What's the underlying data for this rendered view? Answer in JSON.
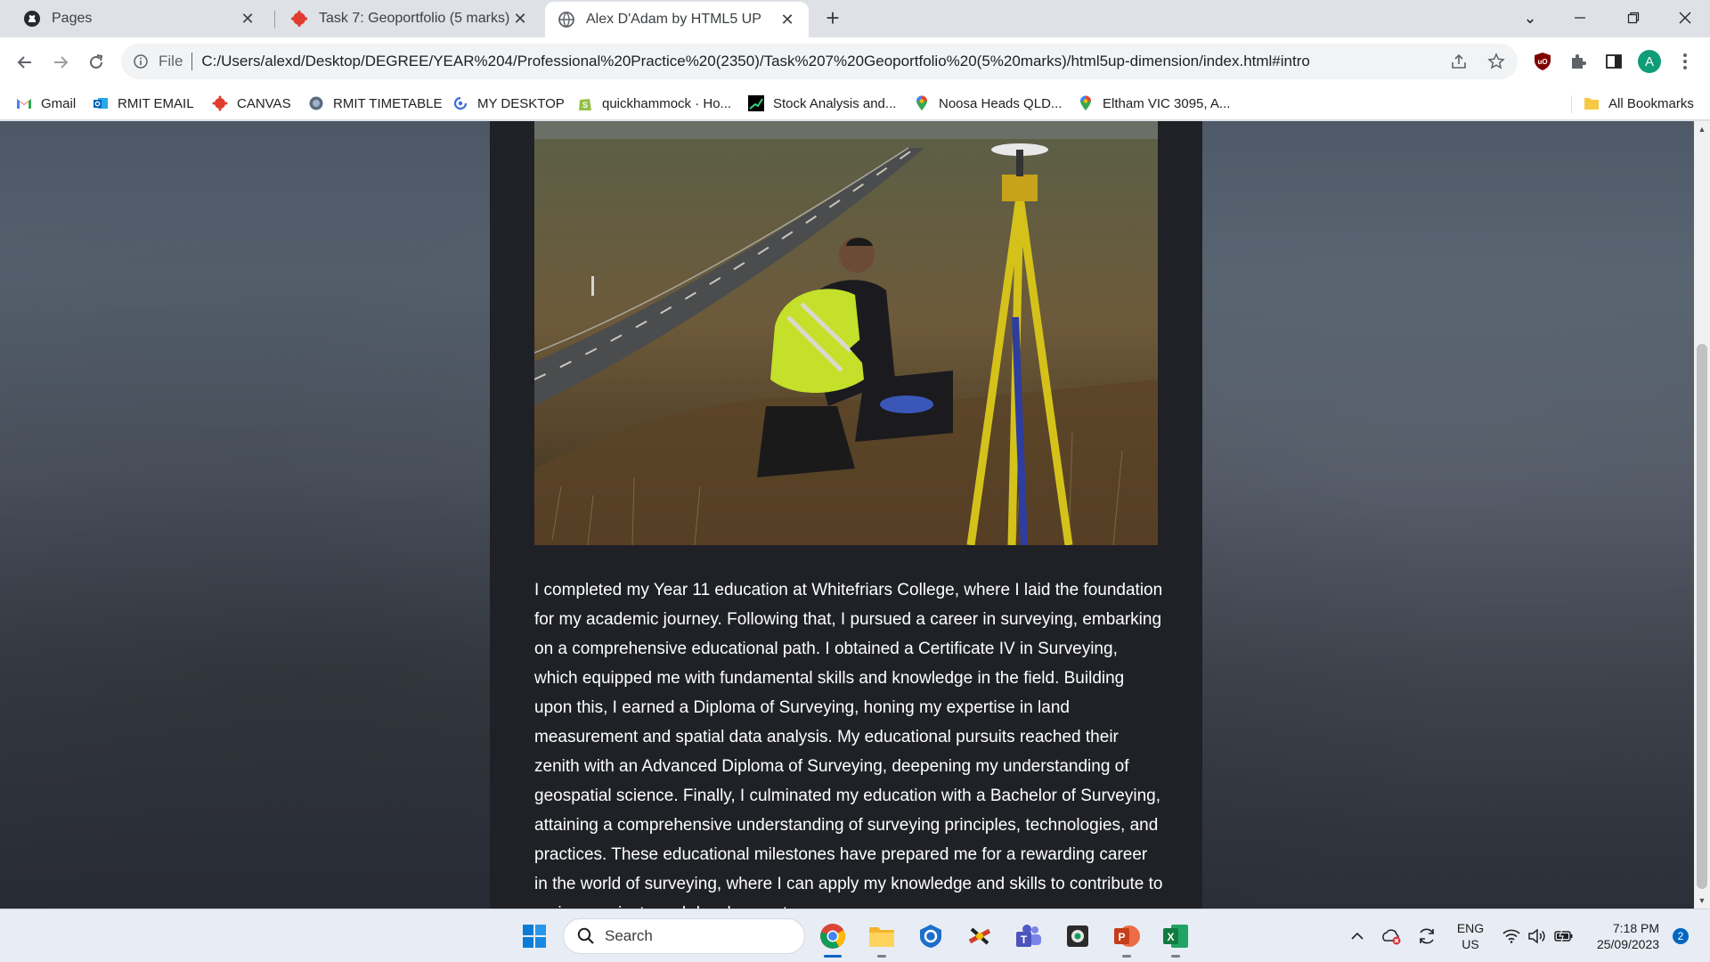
{
  "browser": {
    "tabs": [
      {
        "label": "Pages",
        "icon": "github-icon",
        "active": false
      },
      {
        "label": "Task 7: Geoportfolio (5 marks)",
        "icon": "canvas-icon",
        "active": false
      },
      {
        "label": "Alex D'Adam by HTML5 UP",
        "icon": "globe-icon",
        "active": true
      }
    ],
    "new_tab": "+",
    "address": {
      "scheme_label": "File",
      "url": "C:/Users/alexd/Desktop/DEGREE/YEAR%204/Professional%20Practice%20(2350)/Task%207%20Geoportfolio%20(5%20marks)/html5up-dimension/index.html#intro"
    },
    "profile_initial": "A",
    "bookmarks": [
      {
        "label": "Gmail",
        "icon": "gmail-icon"
      },
      {
        "label": "RMIT EMAIL",
        "icon": "outlook-icon"
      },
      {
        "label": "CANVAS",
        "icon": "canvas-icon"
      },
      {
        "label": "RMIT TIMETABLE",
        "icon": "timetable-icon"
      },
      {
        "label": "MY DESKTOP",
        "icon": "desktop-icon"
      },
      {
        "label": "quickhammock · Ho...",
        "icon": "shopify-icon"
      },
      {
        "label": "Stock Analysis and...",
        "icon": "stock-icon"
      },
      {
        "label": "Noosa Heads QLD...",
        "icon": "map-pin-icon"
      },
      {
        "label": "Eltham VIC 3095, A...",
        "icon": "map-pin-icon"
      }
    ],
    "all_bookmarks": "All Bookmarks"
  },
  "page": {
    "photo_alt": "Surveyor kneeling beside GNSS receiver on tripod next to rural road",
    "body": "I completed my Year 11 education at Whitefriars College, where I laid the foundation for my academic journey. Following that, I pursued a career in surveying, embarking on a comprehensive educational path. I obtained a Certificate IV in Surveying, which equipped me with fundamental skills and knowledge in the field. Building upon this, I earned a Diploma of Surveying, honing my expertise in land measurement and spatial data analysis. My educational pursuits reached their zenith with an Advanced Diploma of Surveying, deepening my understanding of geospatial science. Finally, I culminated my education with a Bachelor of Surveying, attaining a comprehensive understanding of surveying principles, technologies, and practices. These educational milestones have prepared me for a rewarding career in the world of surveying, where I can apply my knowledge and skills to contribute to various projects and developments."
  },
  "taskbar": {
    "search_placeholder": "Search",
    "language": {
      "line1": "ENG",
      "line2": "US"
    },
    "time": "7:18 PM",
    "date": "25/09/2023",
    "notification_count": "2"
  }
}
